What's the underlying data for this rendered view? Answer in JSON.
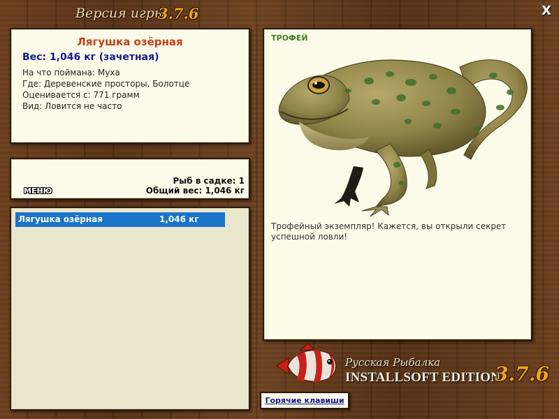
{
  "window": {
    "title": "Версия игры",
    "version": "3.7.6",
    "close_label": "X"
  },
  "fish_info": {
    "name": "Лягушка озёрная",
    "weight_line": "Вес: 1,046 кг (зачетная)",
    "bait_line": "На что поймана: Муха",
    "place_line": "Где: Деревенские просторы, Болотце",
    "rating_line": "Оценивается с: 771 грамм",
    "kind_line": "Вид: Ловится не часто"
  },
  "cage": {
    "menu_label": "МЕНЮ",
    "count_line": "Рыб в садке: 1",
    "total_weight_line": "Общий вес: 1,046 кг"
  },
  "catch_list": [
    {
      "name": "Лягушка озёрная",
      "weight": "1,046 кг",
      "selected": true
    }
  ],
  "trophy": {
    "label": "ТРОФЕЙ",
    "image": "frog-image",
    "description": "Трофейный экземпляр! Кажется, вы открыли секрет успешной ловли!"
  },
  "logo": {
    "line1": "Русская Рыбалка",
    "line2": "INSTALLSOFT EDITION",
    "version": "3.7.6",
    "fish_icon": "red-white-striped-fish-icon"
  },
  "hotkeys_label": "Горячие клавиши",
  "colors": {
    "fish_name": "#c3411b",
    "weight_blue": "#13198b",
    "selection": "#1a74c9",
    "trophy_green": "#3f7e22",
    "version_orange": "#f2a51a",
    "panel_bg": "#fdfbea"
  }
}
